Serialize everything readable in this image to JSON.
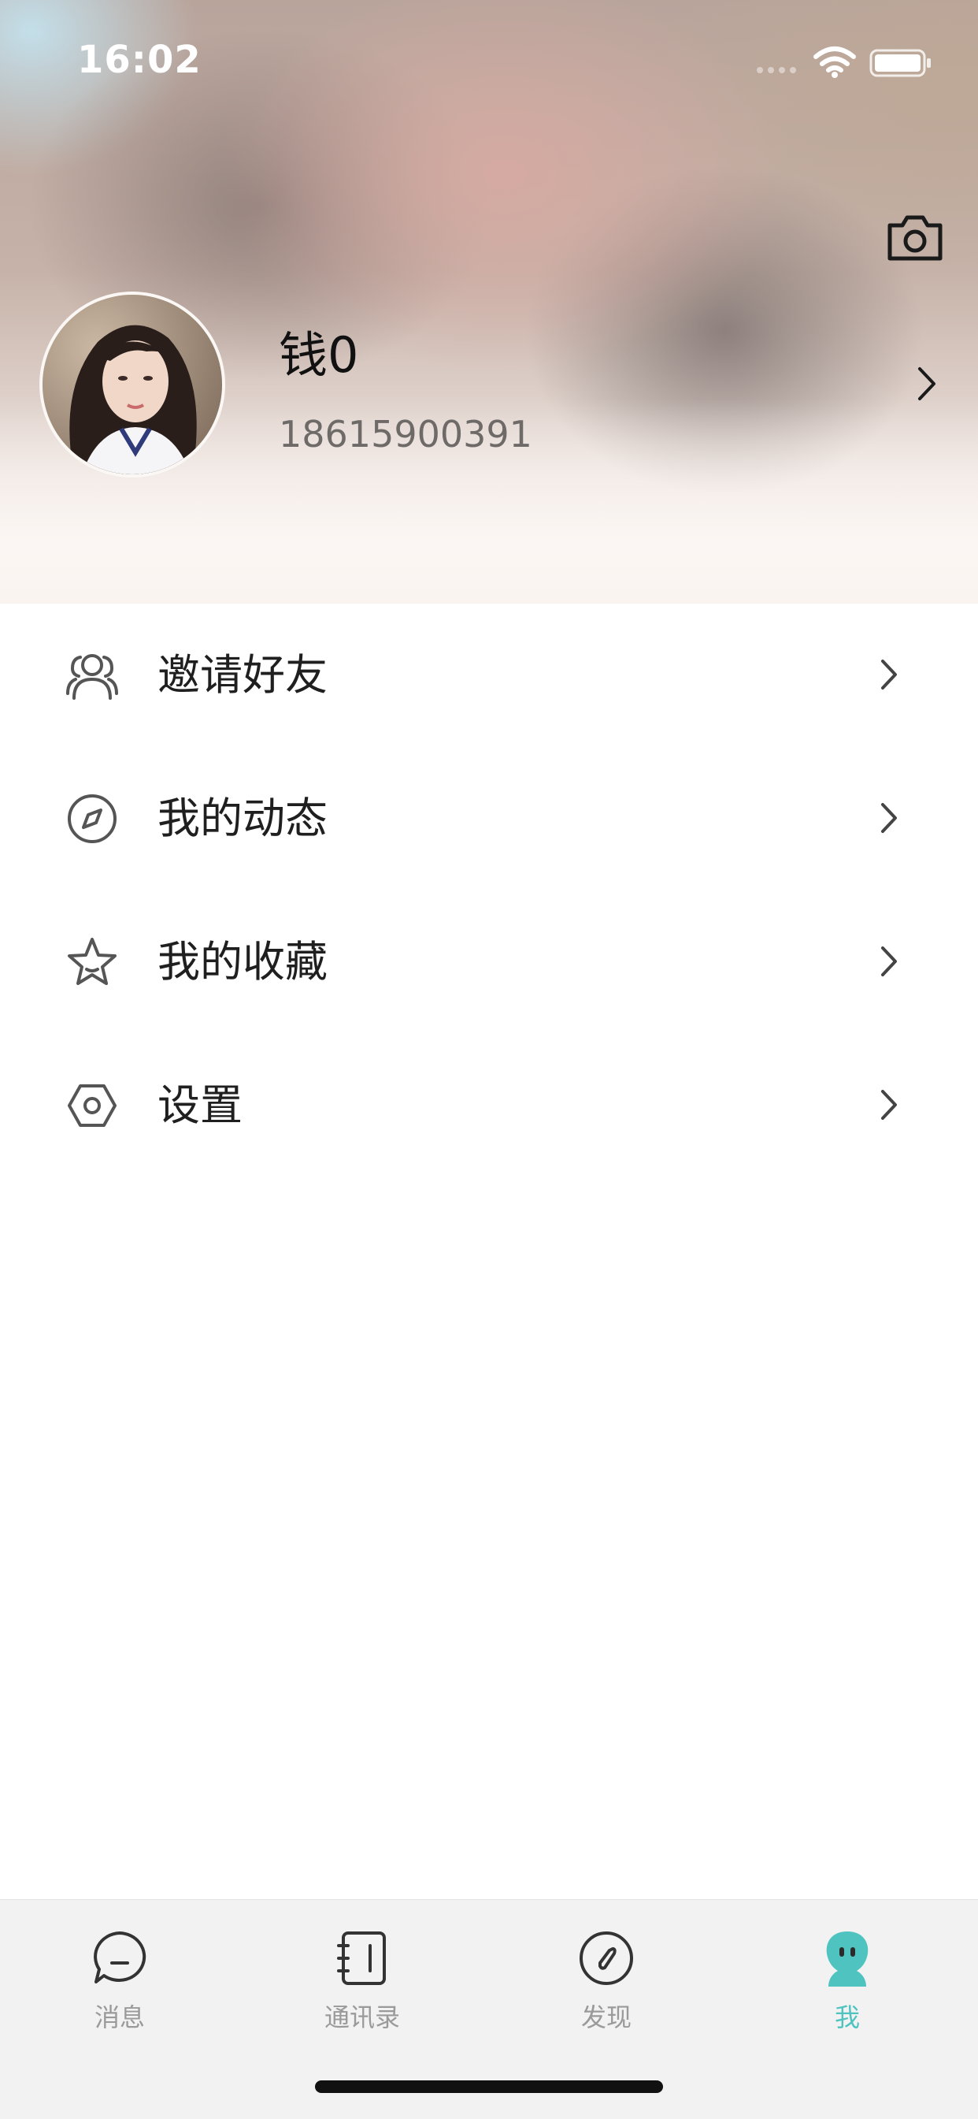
{
  "status_bar": {
    "time": "16:02",
    "icons": [
      "signal-icon",
      "wifi-icon",
      "battery-icon"
    ]
  },
  "profile": {
    "name": "钱0",
    "phone": "18615900391",
    "avatar": "avatar-photo",
    "camera_icon": "camera-icon",
    "chevron_icon": "chevron-right-icon"
  },
  "menu": {
    "items": [
      {
        "label": "邀请好友",
        "icon": "users-icon"
      },
      {
        "label": "我的动态",
        "icon": "compass-icon"
      },
      {
        "label": "我的收藏",
        "icon": "star-icon"
      },
      {
        "label": "设置",
        "icon": "hexagon-gear-icon"
      }
    ]
  },
  "tabbar": {
    "tabs": [
      {
        "label": "消息",
        "icon": "chat-bubble-icon",
        "active": false
      },
      {
        "label": "通讯录",
        "icon": "contacts-book-icon",
        "active": false
      },
      {
        "label": "发现",
        "icon": "compass-icon",
        "active": false
      },
      {
        "label": "我",
        "icon": "ghost-icon",
        "active": true
      }
    ]
  },
  "colors": {
    "accent": "#4fc3c0",
    "tab_inactive": "#9a9a9a",
    "text_primary": "#1f1f1f",
    "text_secondary": "#6e6a68"
  }
}
